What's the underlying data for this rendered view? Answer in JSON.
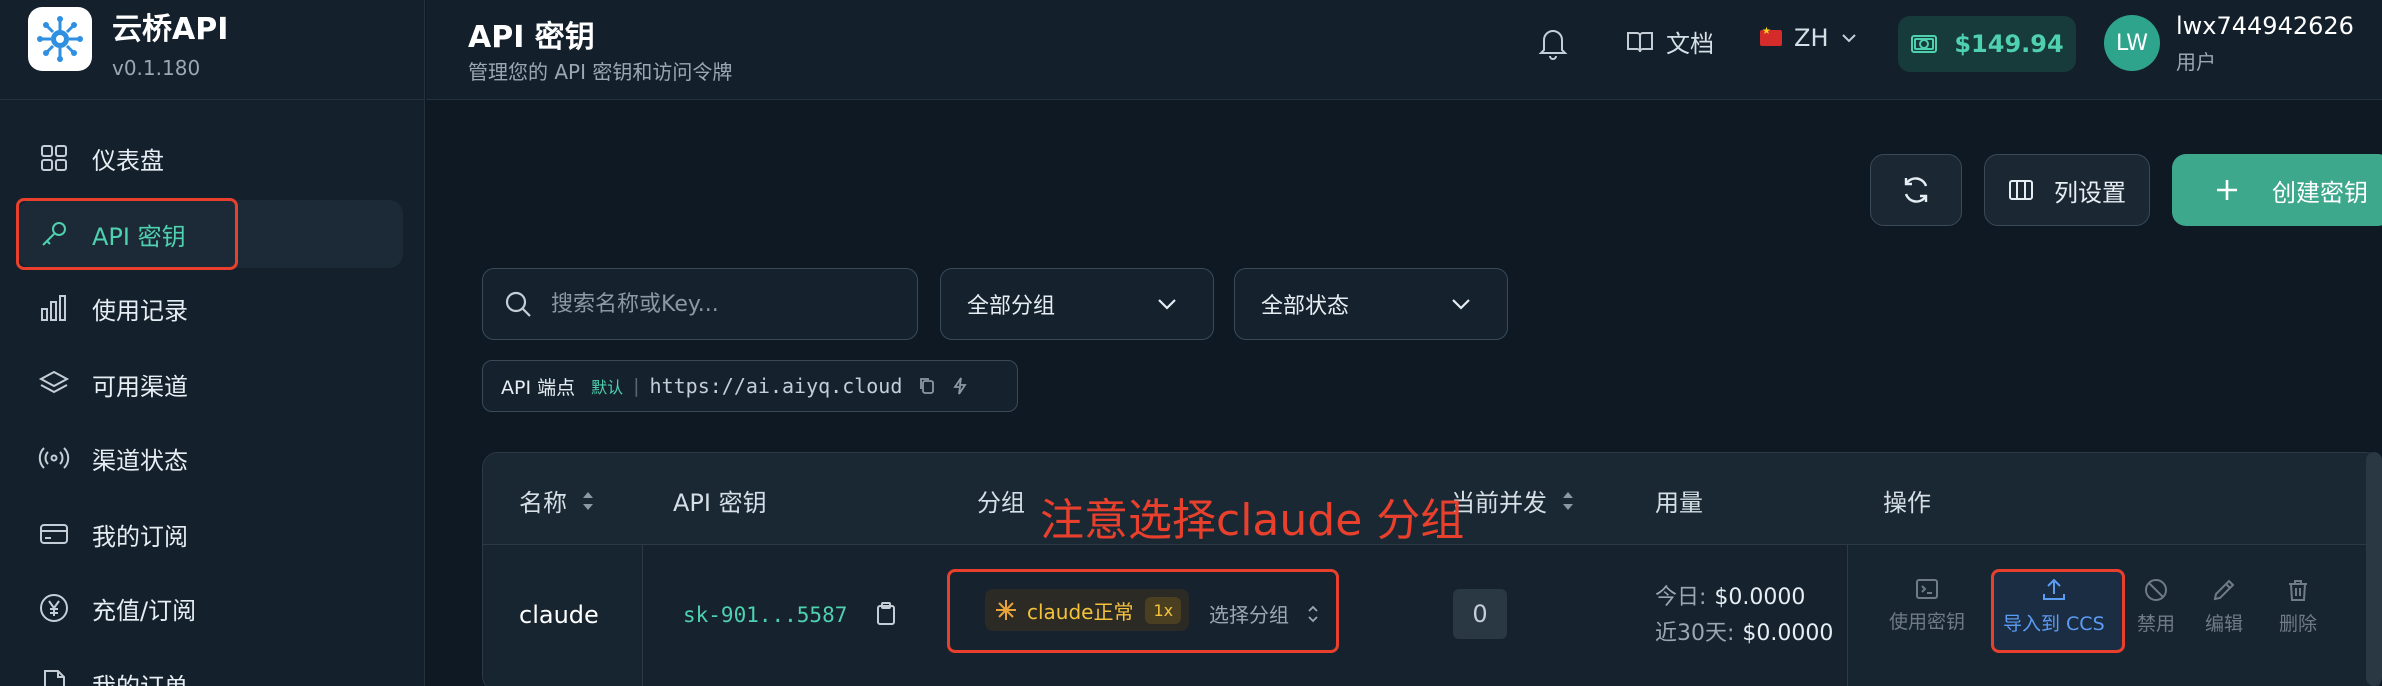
{
  "brand": {
    "name": "云桥API",
    "version": "v0.1.180"
  },
  "sidebar": {
    "items": [
      {
        "label": "仪表盘",
        "icon": "dashboard-icon"
      },
      {
        "label": "API 密钥",
        "icon": "key-icon",
        "active": true
      },
      {
        "label": "使用记录",
        "icon": "bar-chart-icon"
      },
      {
        "label": "可用渠道",
        "icon": "layers-icon"
      },
      {
        "label": "渠道状态",
        "icon": "signal-icon"
      },
      {
        "label": "我的订阅",
        "icon": "credit-card-icon"
      },
      {
        "label": "充值/订阅",
        "icon": "yen-icon"
      },
      {
        "label": "我的订单",
        "icon": "document-icon"
      }
    ]
  },
  "header": {
    "title": "API 密钥",
    "subtitle": "管理您的 API 密钥和访问令牌",
    "docs_label": "文档",
    "lang_label": "ZH",
    "balance": "$149.94",
    "avatar_initials": "LW",
    "user_name": "lwx744942626",
    "user_role": "用户"
  },
  "toolbar": {
    "columns_label": "列设置",
    "create_label": "创建密钥"
  },
  "filters": {
    "search_placeholder": "搜索名称或Key...",
    "group_select": "全部分组",
    "status_select": "全部状态"
  },
  "endpoint": {
    "label": "API 端点",
    "default_badge": "默认",
    "url": "https://ai.aiyq.cloud"
  },
  "table": {
    "columns": {
      "name": "名称",
      "key": "API 密钥",
      "group": "分组",
      "concurrency": "当前并发",
      "usage": "用量",
      "ops": "操作"
    },
    "rows": [
      {
        "name": "claude",
        "key": "sk-901...5587",
        "group_name": "claude正常",
        "group_multiplier": "1x",
        "group_select_label": "选择分组",
        "concurrency": "0",
        "usage_today_label": "今日:",
        "usage_today": "$0.0000",
        "usage_30_label": "近30天:",
        "usage_30": "$0.0000",
        "ops": {
          "use_key": "使用密钥",
          "import_ccs": "导入到 CCS",
          "disable": "禁用",
          "edit": "编辑",
          "delete": "删除"
        }
      }
    ]
  },
  "annotation": "注意选择claude 分组",
  "colors": {
    "accent": "#4fd1b0",
    "highlight_red": "#e8402c",
    "background": "#0f1923",
    "link_blue": "#5b9cf5"
  }
}
